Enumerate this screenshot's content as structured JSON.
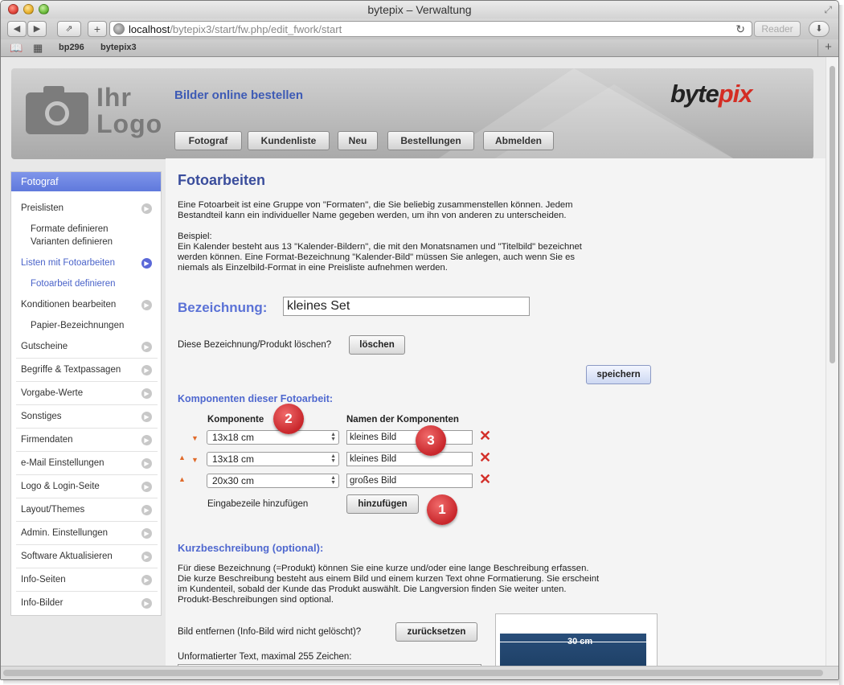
{
  "window": {
    "title": "bytepix – Verwaltung"
  },
  "browser": {
    "url_host": "localhost",
    "url_path": "/bytepix3/start/fw.php/edit_fwork/start",
    "reader_label": "Reader",
    "bookmarks": [
      "bp296",
      "bytepix3"
    ]
  },
  "header": {
    "logo_line1": "Ihr",
    "logo_line2": "Logo",
    "tagline": "Bilder online bestellen",
    "brand_main": "byte",
    "brand_accent": "pix",
    "nav": [
      "Fotograf",
      "Kundenliste",
      "Neu",
      "Bestellungen",
      "Abmelden"
    ]
  },
  "sidebar": {
    "heading": "Fotograf",
    "items": [
      "Preislisten",
      "Formate definieren",
      "Varianten definieren",
      "Listen mit Fotoarbeiten",
      "Fotoarbeit definieren",
      "Konditionen bearbeiten",
      "Papier-Bezeichnungen",
      "Gutscheine",
      "Begriffe & Textpassagen",
      "Vorgabe-Werte",
      "Sonstiges",
      "Firmendaten",
      "e-Mail Einstellungen",
      "Logo & Login-Seite",
      "Layout/Themes",
      "Admin. Einstellungen",
      "Software Aktualisieren",
      "Info-Seiten",
      "Info-Bilder"
    ]
  },
  "main": {
    "title": "Fotoarbeiten",
    "intro_1": "Eine Fotoarbeit ist eine Gruppe von \"Formaten\", die Sie beliebig zusammenstellen können. Jedem",
    "intro_2": "Bestandteil kann ein individueller Name gegeben werden, um ihn von anderen zu unterscheiden.",
    "example_label": "Beispiel:",
    "example_1": "Ein Kalender besteht aus 13 \"Kalender-Bildern\", die mit den Monatsnamen und \"Titelbild\" bezeichnet",
    "example_2": "werden können. Eine Format-Bezeichnung \"Kalender-Bild\" müssen Sie anlegen, auch wenn Sie es",
    "example_3": "niemals als Einzelbild-Format in eine Preisliste aufnehmen werden.",
    "name_label": "Bezeichnung:",
    "name_value": "kleines Set",
    "delete_prompt": "Diese Bezeichnung/Produkt löschen?",
    "delete_button": "löschen",
    "save_button": "speichern",
    "components_title": "Komponenten dieser Fotoarbeit:",
    "col_component": "Komponente",
    "col_names": "Namen der Komponenten",
    "components": [
      {
        "format": "13x18 cm",
        "name": "kleines Bild"
      },
      {
        "format": "13x18 cm",
        "name": "kleines Bild"
      },
      {
        "format": "20x30 cm",
        "name": "großes Bild"
      }
    ],
    "add_row_label": "Eingabezeile hinzufügen",
    "add_button": "hinzufügen",
    "badges": [
      "1",
      "2",
      "3"
    ],
    "short_desc_title": "Kurzbeschreibung (optional):",
    "short_desc_1": "Für diese Bezeichnung (=Produkt) können Sie eine kurze und/oder eine lange Beschreibung erfassen.",
    "short_desc_2": "Die kurze Beschreibung besteht aus einem Bild und einem kurzen Text ohne Formatierung. Sie erscheint",
    "short_desc_3": "im Kundenteil, sobald der Kunde das Produkt auswählt. Die Langversion finden Sie weiter unten.",
    "short_desc_4": "Produkt-Beschreibungen sind optional.",
    "remove_image_prompt": "Bild entfernen (Info-Bild wird nicht gelöscht)?",
    "reset_button": "zurücksetzen",
    "text_label": "Unformatierter Text, maximal 255 Zeichen:",
    "preview_dimension": "30 cm"
  }
}
